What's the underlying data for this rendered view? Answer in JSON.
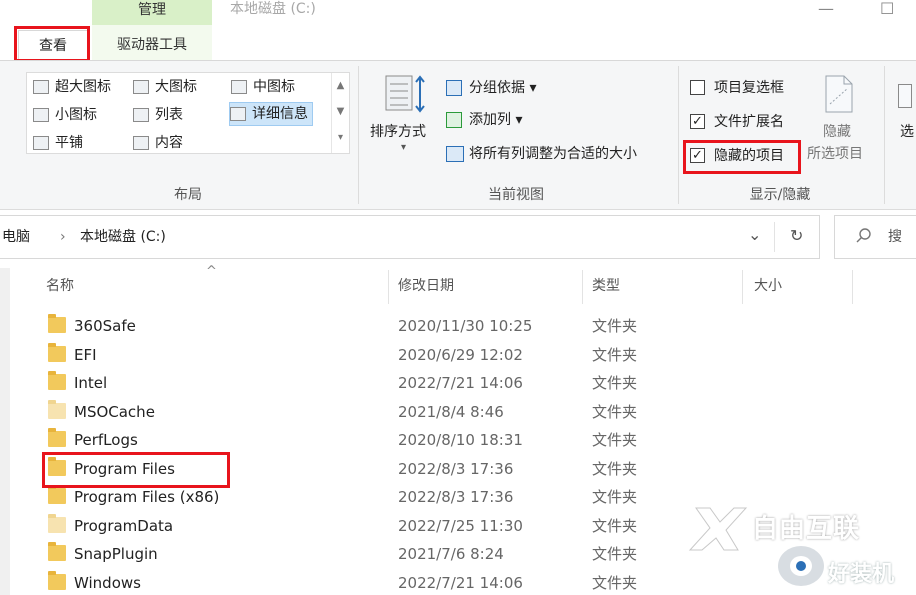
{
  "titlebar": {
    "context_tab": "管理",
    "window_title": "本地磁盘 (C:)",
    "minimize_glyph": "—",
    "maximize_glyph": "☐"
  },
  "ribbon_tabs": [
    {
      "label": "查看"
    },
    {
      "label": "驱动器工具"
    }
  ],
  "ribbon": {
    "layout": {
      "label": "布局",
      "items": [
        {
          "label": "超大图标"
        },
        {
          "label": "大图标"
        },
        {
          "label": "中图标"
        },
        {
          "label": "小图标"
        },
        {
          "label": "列表"
        },
        {
          "label": "详细信息"
        },
        {
          "label": "平铺"
        },
        {
          "label": "内容"
        }
      ],
      "selected": "详细信息"
    },
    "current_view": {
      "label": "当前视图",
      "sort_label": "排序方式",
      "group_by": "分组依据",
      "add_column": "添加列",
      "fit_columns": "将所有列调整为合适的大小",
      "dropdown_glyph": "▾"
    },
    "show_hide": {
      "label": "显示/隐藏",
      "checkboxes": [
        {
          "label": "项目复选框",
          "checked": false
        },
        {
          "label": "文件扩展名",
          "checked": true
        },
        {
          "label": "隐藏的项目",
          "checked": true
        }
      ],
      "hide_button": {
        "line1": "隐藏",
        "line2": "所选项目"
      }
    },
    "partial_right": "选"
  },
  "address": {
    "crumb_this_pc": "电脑",
    "separator": "›",
    "crumb_drive": "本地磁盘 (C:)",
    "dropdown_glyph": "⌄",
    "refresh_glyph": "↻",
    "search_placeholder": "搜"
  },
  "columns": {
    "sort_indicator": "^",
    "name": "名称",
    "date": "修改日期",
    "type": "类型",
    "size": "大小"
  },
  "files": [
    {
      "name": "360Safe",
      "date": "2020/11/30 10:25",
      "type": "文件夹",
      "pale": false
    },
    {
      "name": "EFI",
      "date": "2020/6/29 12:02",
      "type": "文件夹",
      "pale": false
    },
    {
      "name": "Intel",
      "date": "2022/7/21 14:06",
      "type": "文件夹",
      "pale": false
    },
    {
      "name": "MSOCache",
      "date": "2021/8/4 8:46",
      "type": "文件夹",
      "pale": true
    },
    {
      "name": "PerfLogs",
      "date": "2020/8/10 18:31",
      "type": "文件夹",
      "pale": false
    },
    {
      "name": "Program Files",
      "date": "2022/8/3 17:36",
      "type": "文件夹",
      "pale": false
    },
    {
      "name": "Program Files (x86)",
      "date": "2022/8/3 17:36",
      "type": "文件夹",
      "pale": false
    },
    {
      "name": "ProgramData",
      "date": "2022/7/25 11:30",
      "type": "文件夹",
      "pale": true
    },
    {
      "name": "SnapPlugin",
      "date": "2021/7/6 8:24",
      "type": "文件夹",
      "pale": false
    },
    {
      "name": "Windows",
      "date": "2022/7/21 14:06",
      "type": "文件夹",
      "pale": false
    }
  ],
  "watermark": {
    "line1": "自由互联",
    "line2": "好装机"
  },
  "colors": {
    "highlight_red": "#e8141c",
    "context_tab_green": "#d9f0c8",
    "selected_blue": "#cde5f9",
    "folder_yellow": "#f2c95c"
  }
}
